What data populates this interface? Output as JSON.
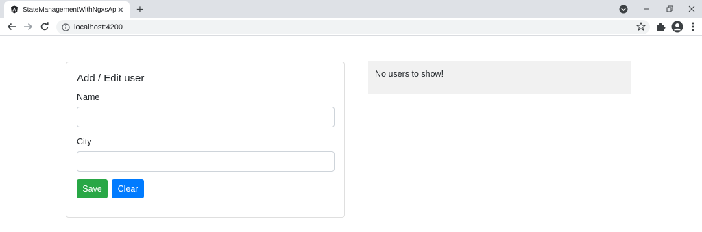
{
  "browser": {
    "tab_title": "StateManagementWithNgxsApp",
    "url": "localhost:4200"
  },
  "form": {
    "title": "Add / Edit user",
    "name_label": "Name",
    "name_value": "",
    "city_label": "City",
    "city_value": "",
    "save_label": "Save",
    "clear_label": "Clear"
  },
  "users": {
    "empty_message": "No users to show!"
  },
  "colors": {
    "save": "#28a745",
    "clear": "#007bff",
    "panel_bg": "#f1f1f1"
  },
  "icons": {
    "favicon": "angular-icon",
    "back": "back-arrow-icon",
    "forward": "forward-arrow-icon",
    "reload": "reload-icon",
    "info": "info-icon",
    "star": "star-icon",
    "extensions": "puzzle-icon",
    "profile": "profile-icon",
    "menu": "kebab-menu-icon"
  }
}
